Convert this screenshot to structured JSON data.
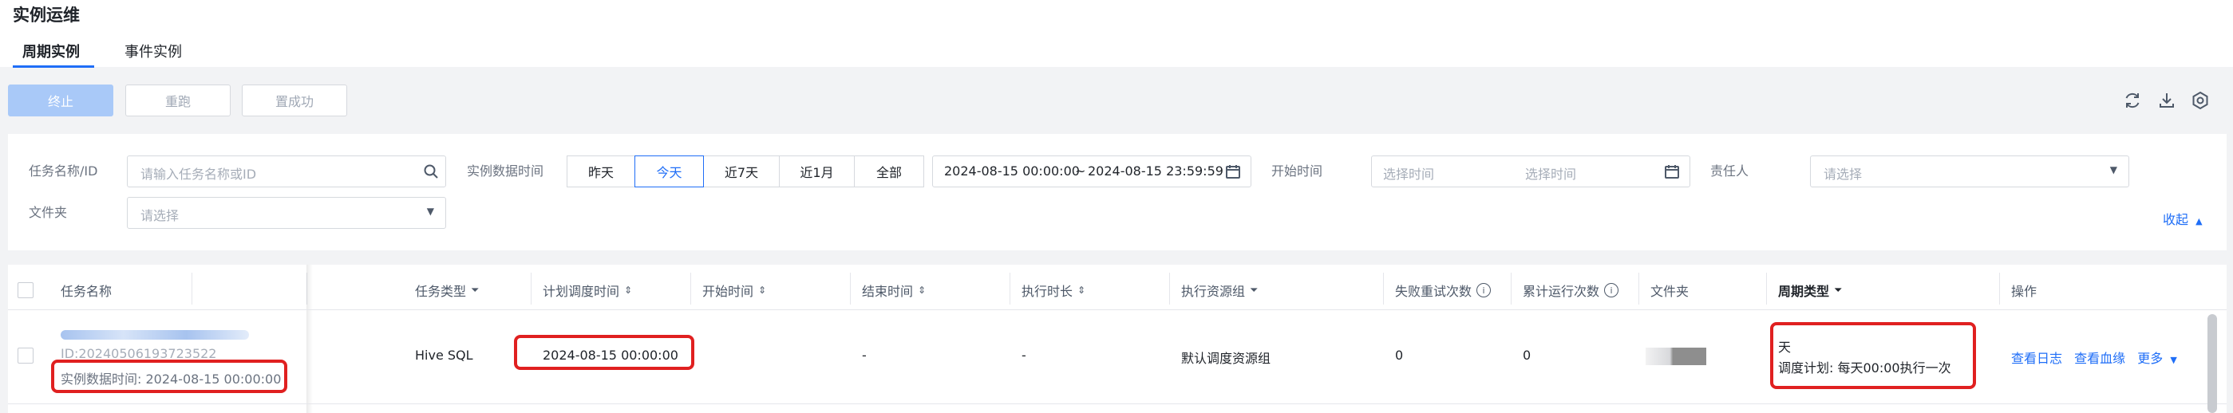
{
  "page": {
    "title": "实例运维"
  },
  "tabs": [
    {
      "label": "周期实例",
      "active": true
    },
    {
      "label": "事件实例",
      "active": false
    }
  ],
  "toolbar": {
    "stop": "终止",
    "rerun": "重跑",
    "set_success": "置成功"
  },
  "icons": {
    "refresh": "refresh-icon",
    "download": "download-icon",
    "settings": "gear-icon"
  },
  "filters": {
    "task_name": {
      "label": "任务名称/ID",
      "placeholder": "请输入任务名称或ID"
    },
    "instance_data_time": {
      "label": "实例数据时间",
      "options": [
        "昨天",
        "今天",
        "近7天",
        "近1月",
        "全部"
      ],
      "selected": "今天",
      "start": "2024-08-15 00:00:00",
      "separator": "~",
      "end": "2024-08-15 23:59:59"
    },
    "start_time": {
      "label": "开始时间",
      "start_placeholder": "选择时间",
      "end_placeholder": "选择时间"
    },
    "owner": {
      "label": "责任人",
      "placeholder": "请选择"
    },
    "folder": {
      "label": "文件夹",
      "placeholder": "请选择"
    },
    "collapse": "收起"
  },
  "table": {
    "columns": [
      "任务名称",
      "任务类型",
      "计划调度时间",
      "开始时间",
      "结束时间",
      "执行时长",
      "执行资源组",
      "失败重试次数",
      "累计运行次数",
      "文件夹",
      "周期类型",
      "操作"
    ],
    "rows": [
      {
        "task_id": "ID:20240506193723522",
        "instance_data_time": "实例数据时间: 2024-08-15 00:00:00",
        "task_type": "Hive SQL",
        "scheduled_time": "2024-08-15 00:00:00",
        "start_time": "",
        "end_time": "-",
        "duration": "-",
        "resource_group": "默认调度资源组",
        "failed_retries": "0",
        "total_runs": "0",
        "cycle_type": "天",
        "schedule_plan": "调度计划: 每天00:00执行一次",
        "actions": [
          "查看日志",
          "查看血缘",
          "更多"
        ]
      }
    ]
  },
  "colors": {
    "accent": "#1f6ef7",
    "highlight": "#e02020",
    "disabled_primary": "#a9c9f8"
  }
}
